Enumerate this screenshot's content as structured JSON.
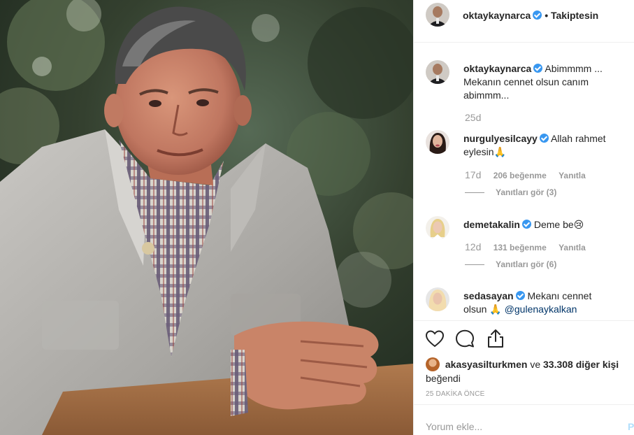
{
  "post": {
    "author": "oktaykaynarca",
    "follow_status": "Takiptesin",
    "photo_alt": "photo"
  },
  "comments": [
    {
      "username": "oktaykaynarca",
      "text_line1": "Abimmmm ...",
      "text_line2": "Mekanın cennet olsun canım",
      "text_line3": "abimmm...",
      "age": "25d"
    },
    {
      "username": "nurgulyesilcayy",
      "text_line1": "Allah rahmet",
      "text_line2": "eylesin🙏",
      "age": "17d",
      "likes": "206 beğenme",
      "reply_label": "Yanıtla",
      "view_replies": "Yanıtları gör (3)"
    },
    {
      "username": "demetakalin",
      "text_line1": "Deme be😢",
      "age": "12d",
      "likes": "131 beğenme",
      "reply_label": "Yanıtla",
      "view_replies": "Yanıtları gör (6)"
    },
    {
      "username": "sedasayan",
      "text_line1": "Mekanı cennet",
      "text_line2": "olsun 🙏",
      "mention": "@gulenaykalkan"
    }
  ],
  "likes": {
    "first_user": "akasyasilturkmen",
    "and": "ve",
    "others": "33.308 diğer kişi",
    "liked": "beğendi"
  },
  "time_ago": "25 DAKİKA ÖNCE",
  "composer": {
    "placeholder": "Yorum ekle...",
    "post_label": "Pa"
  },
  "colors": {
    "verified": "#3897f0",
    "muted": "#999999",
    "post_button": "#b2dffc"
  }
}
